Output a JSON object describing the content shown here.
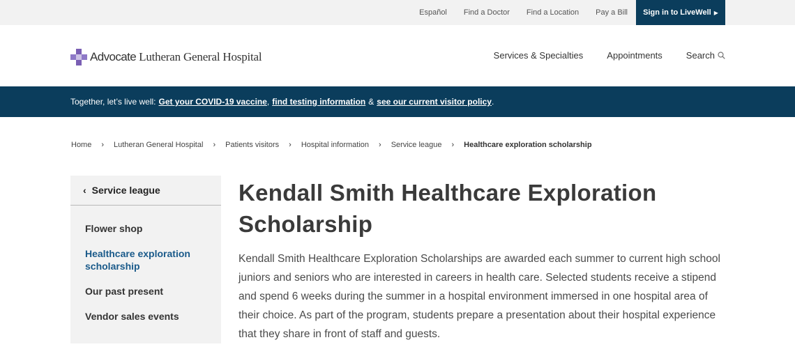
{
  "utility": {
    "links": [
      "Español",
      "Find a Doctor",
      "Find a Location",
      "Pay a Bill"
    ],
    "signin_label": "Sign in to LiveWell"
  },
  "header": {
    "logo_brand": "Advocate",
    "logo_hospital": "Lutheran General Hospital",
    "nav": {
      "services": "Services & Specialties",
      "appointments": "Appointments",
      "search": "Search"
    }
  },
  "alert": {
    "prefix": "Together, let’s live well:",
    "vaccine_link": "Get your COVID-19 vaccine",
    "testing_link": "find testing information",
    "amp": "&",
    "visitor_link": "see our current visitor policy",
    "suffix": "."
  },
  "breadcrumb": {
    "items": [
      "Home",
      "Lutheran General Hospital",
      "Patients visitors",
      "Hospital information",
      "Service league",
      "Healthcare exploration scholarship"
    ]
  },
  "sidebar": {
    "parent_label": "Service league",
    "items": [
      "Flower shop",
      "Healthcare exploration scholarship",
      "Our past present",
      "Vendor sales events"
    ]
  },
  "main": {
    "title": "Kendall Smith Healthcare Exploration Scholarship",
    "body": "Kendall Smith Healthcare Exploration Scholarships are awarded each summer to current high school juniors and seniors who are interested in careers in health care. Selected students receive a stipend and spend 6 weeks during the summer in a hospital environment immersed in one hospital area of their choice. As part of the program, students prepare a presentation about their hospital experience that they share in front of staff and guests."
  },
  "colors": {
    "brand_navy": "#0b3d5c",
    "logo_purple": "#7a5fb4",
    "active_link": "#1a5a8a"
  },
  "icons": [
    "logo-cross-icon",
    "search-icon",
    "chevron-right-icon",
    "chevron-left-icon"
  ]
}
